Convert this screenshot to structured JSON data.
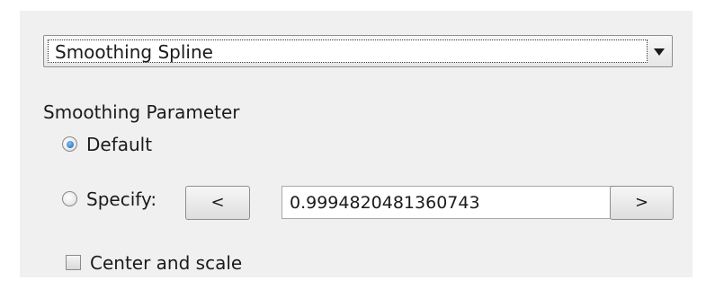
{
  "fit_type": {
    "selected": "Smoothing Spline"
  },
  "smoothing_parameter": {
    "label": "Smoothing Parameter",
    "options": [
      {
        "label": "Default",
        "checked": true
      },
      {
        "label": "Specify:",
        "checked": false
      }
    ],
    "decrement_label": "<",
    "increment_label": ">",
    "value": "0.9994820481360743"
  },
  "center_and_scale": {
    "label": "Center and scale",
    "checked": false
  },
  "icons": {
    "dropdown_arrow": "triangle-down-icon"
  }
}
